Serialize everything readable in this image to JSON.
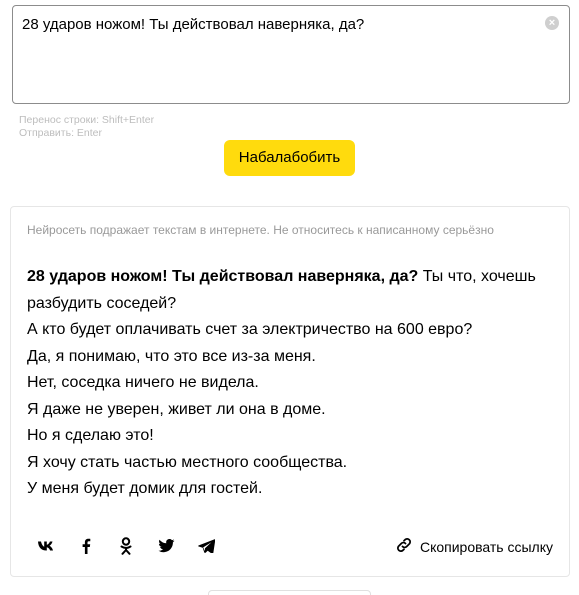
{
  "input": {
    "value": "28 ударов ножом! Ты действовал наверняка, да?",
    "clear_icon": "×"
  },
  "hints": {
    "line_break": "Перенос строки: Shift+Enter",
    "send": "Отправить: Enter"
  },
  "submit_label": "Набалабобить",
  "result": {
    "disclaimer": "Нейросеть подражает текстам в интернете. Не относитесь к написанному серьёзно",
    "prompt": "28 ударов ножом! Ты действовал наверняка, да?",
    "first_line_rest": " Ты что, хочешь разбудить соседей?",
    "lines": [
      "А кто будет оплачивать счет за электричество на 600 евро?",
      "Да, я понимаю, что это все из-за меня.",
      "Нет, соседка ничего не видела.",
      "Я даже не уверен, живет ли она в доме.",
      "Но я сделаю это!",
      "Я хочу стать частью местного сообщества.",
      "У меня будет домик для гостей."
    ]
  },
  "share": {
    "icons": [
      "vk-icon",
      "facebook-icon",
      "odnoklassniki-icon",
      "twitter-icon",
      "telegram-icon"
    ],
    "copy_label": "Скопировать ссылку"
  },
  "colors": {
    "button_yellow": "#ffdb0d",
    "hint_gray": "#bdbdbd",
    "disclaimer_gray": "#999999"
  }
}
